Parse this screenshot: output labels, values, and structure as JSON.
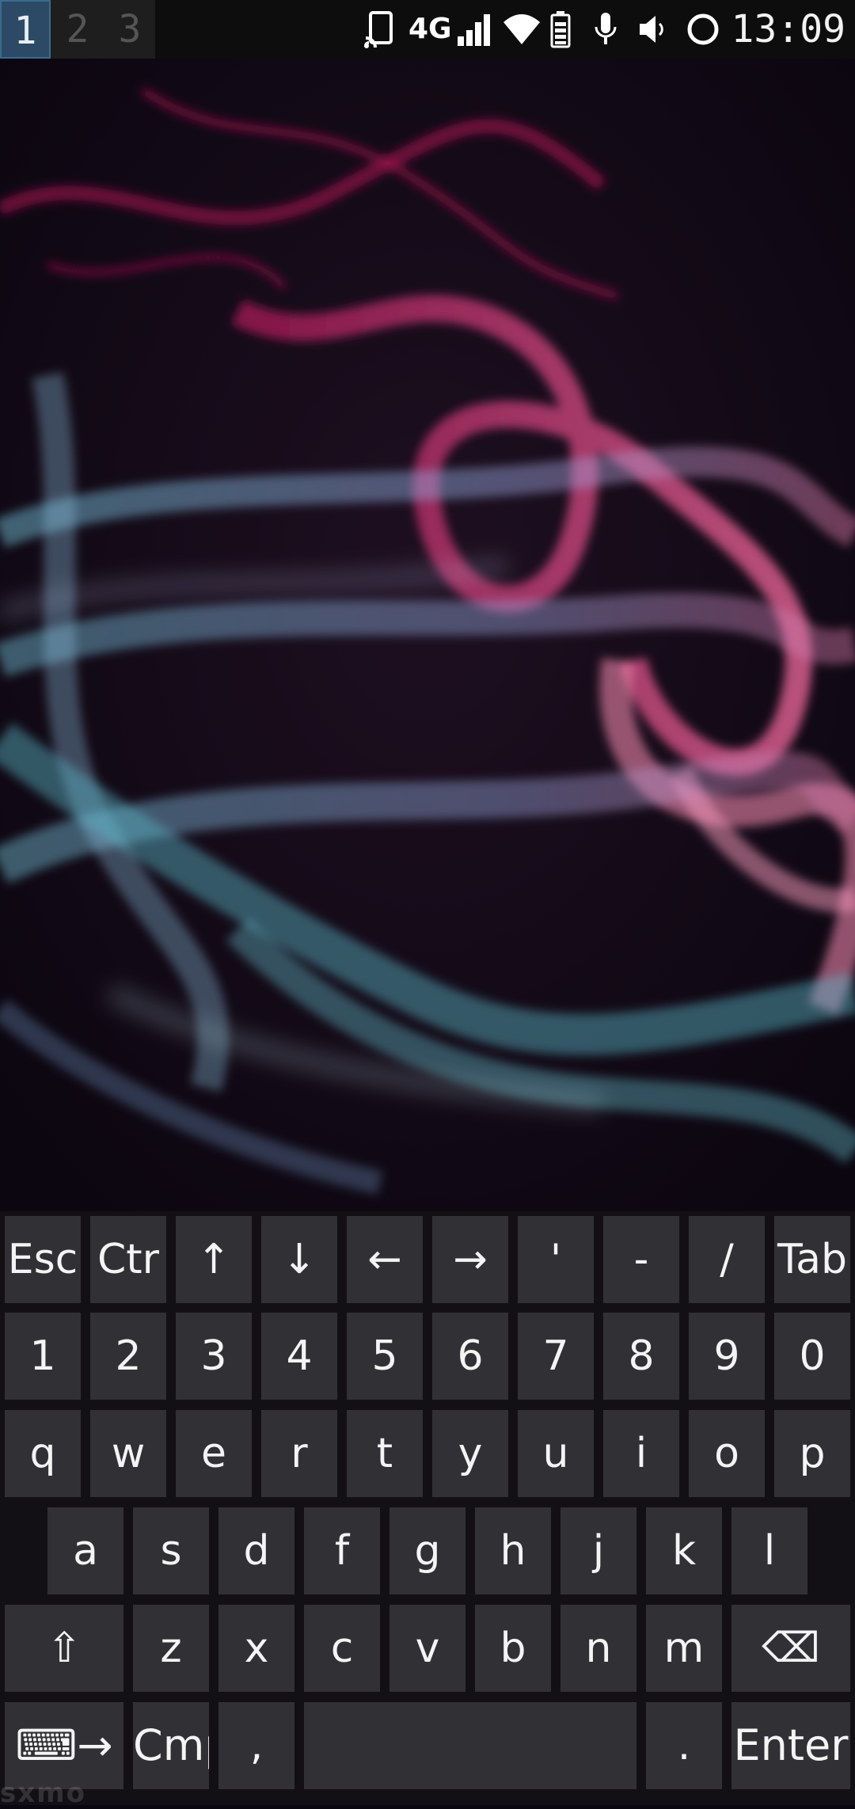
{
  "status_bar": {
    "workspaces": [
      "1",
      "2",
      "3"
    ],
    "active_workspace": "1",
    "network_type": "4G",
    "time": "13:09",
    "icons": [
      "cast-icon",
      "4g-icon",
      "signal-icon",
      "wifi-icon",
      "battery-icon",
      "microphone-icon",
      "volume-icon",
      "circle-status-icon"
    ]
  },
  "keyboard": {
    "rows": [
      [
        "Esc",
        "Ctr",
        "↑",
        "↓",
        "←",
        "→",
        "'",
        "-",
        "/",
        "Tab"
      ],
      [
        "1",
        "2",
        "3",
        "4",
        "5",
        "6",
        "7",
        "8",
        "9",
        "0"
      ],
      [
        "q",
        "w",
        "e",
        "r",
        "t",
        "y",
        "u",
        "i",
        "o",
        "p"
      ],
      [
        "a",
        "s",
        "d",
        "f",
        "g",
        "h",
        "j",
        "k",
        "l"
      ],
      [
        "⇧",
        "z",
        "x",
        "c",
        "v",
        "b",
        "n",
        "m",
        "⌫"
      ],
      [
        "⌨→",
        "Cmp",
        ",",
        "",
        ".",
        "Enter"
      ]
    ]
  },
  "watermark": "sxmo"
}
